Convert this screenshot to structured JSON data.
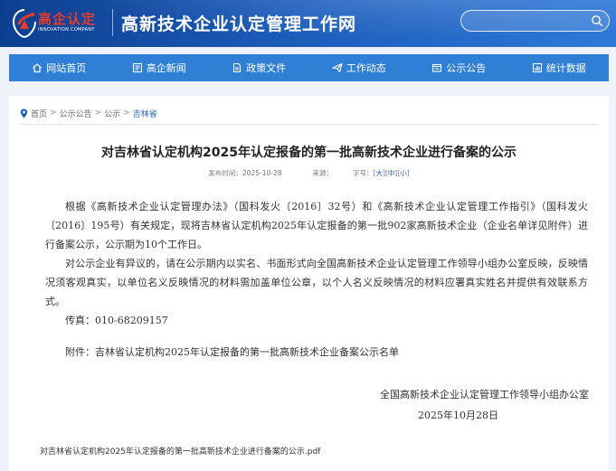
{
  "header": {
    "logo_text": "高企认定",
    "logo_sub": "INNOVATION COMPANY",
    "site_title": "高新技术企业认定管理工作网",
    "search_placeholder": "",
    "colors": {
      "brand_blue": "#1b5bb8",
      "logo_red": "#e63a2a"
    }
  },
  "nav": {
    "items": [
      {
        "label": "网站首页",
        "icon": "home-icon"
      },
      {
        "label": "高企新闻",
        "icon": "news-icon"
      },
      {
        "label": "政策文件",
        "icon": "document-icon"
      },
      {
        "label": "工作动态",
        "icon": "send-icon"
      },
      {
        "label": "公示公告",
        "icon": "announcement-icon"
      },
      {
        "label": "统计数据",
        "icon": "statistics-icon"
      }
    ]
  },
  "breadcrumb": {
    "items": [
      "首页",
      "公示公告",
      "公示"
    ],
    "current": "吉林省",
    "separator": ">"
  },
  "article": {
    "title": "对吉林省认定机构2025年认定报备的第一批高新技术企业进行备案的公示",
    "publish_label": "发布时间：",
    "publish_date": "2025-10-28",
    "publish_suffix": "来源：",
    "font_size_label": "字号：",
    "font_sizes": [
      "大",
      "中",
      "小"
    ],
    "paragraphs": [
      "根据《高新技术企业认定管理办法》（国科发火〔2016〕32号）和《高新技术企业认定管理工作指引》（国科发火〔2016〕195号）有关规定，现将吉林省认定机构2025年认定报备的第一批902家高新技术企业（企业名单详见附件）进行备案公示，公示期为10个工作日。",
      "对公示企业有异议的，请在公示期内以实名、书面形式向全国高新技术企业认定管理工作领导小组办公室反映，反映情况须客观真实，以单位名义反映情况的材料需加盖单位公章，以个人名义反映情况的材料应署真实姓名并提供有效联系方式。",
      "传真：010-68209157"
    ],
    "attachment_note": "附件：吉林省认定机构2025年认定报备的第一批高新技术企业备案公示名单",
    "signature_org": "全国高新技术企业认定管理工作领导小组办公室",
    "signature_date": "2025年10月28日",
    "attachment_file": "对吉林省认定机构2025年认定报备的第一批高新技术企业进行备案的公示.pdf"
  }
}
